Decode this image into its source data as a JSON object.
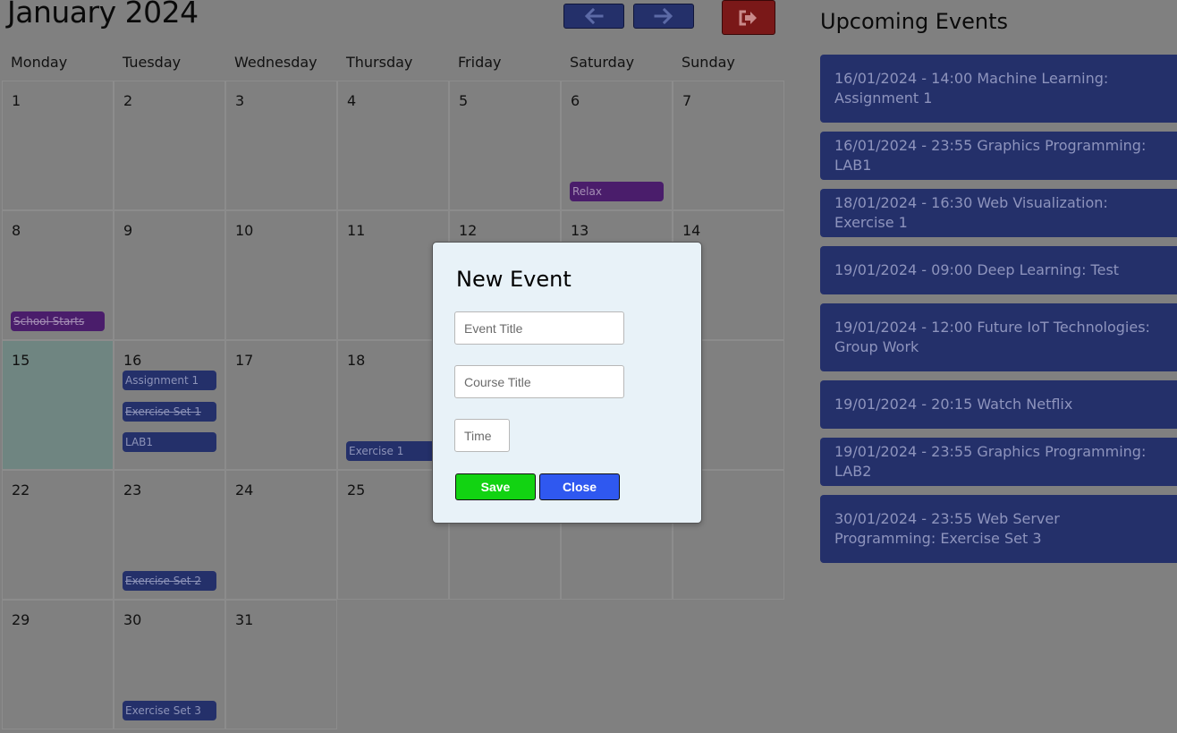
{
  "header": {
    "month_title": "January 2024"
  },
  "colors": {
    "event_blue": "#24306a",
    "event_purple": "#4a1d6b",
    "today": "#6f8581",
    "save": "#12d312",
    "close": "#2f58f0",
    "logout": "#7a1818"
  },
  "icons": {
    "prev": "arrow-left-icon",
    "next": "arrow-right-icon",
    "logout": "sign-out-icon"
  },
  "weekdays": [
    "Monday",
    "Tuesday",
    "Wednesday",
    "Thursday",
    "Friday",
    "Saturday",
    "Sunday"
  ],
  "calendar": {
    "days": [
      {
        "day": "1",
        "events": []
      },
      {
        "day": "2",
        "events": []
      },
      {
        "day": "3",
        "events": []
      },
      {
        "day": "4",
        "events": []
      },
      {
        "day": "5",
        "events": []
      },
      {
        "day": "6",
        "events": [
          {
            "label": "Relax",
            "color": "purple",
            "done": false
          }
        ]
      },
      {
        "day": "7",
        "events": []
      },
      {
        "day": "8",
        "events": [
          {
            "label": "School Starts",
            "color": "purple",
            "done": true
          }
        ]
      },
      {
        "day": "9",
        "events": []
      },
      {
        "day": "10",
        "events": []
      },
      {
        "day": "11",
        "events": []
      },
      {
        "day": "12",
        "events": []
      },
      {
        "day": "13",
        "events": []
      },
      {
        "day": "14",
        "events": []
      },
      {
        "day": "15",
        "events": [],
        "today": true
      },
      {
        "day": "16",
        "events": [
          {
            "label": "Assignment 1",
            "color": "blue",
            "done": false
          },
          {
            "label": "Exercise Set 1",
            "color": "blue",
            "done": true
          },
          {
            "label": "LAB1",
            "color": "blue",
            "done": false
          }
        ]
      },
      {
        "day": "17",
        "events": []
      },
      {
        "day": "18",
        "events": [
          {
            "label": "Exercise 1",
            "color": "blue",
            "done": false
          }
        ]
      },
      {
        "day": "",
        "events": []
      },
      {
        "day": "",
        "events": []
      },
      {
        "day": "",
        "events": []
      },
      {
        "day": "22",
        "events": []
      },
      {
        "day": "23",
        "events": [
          {
            "label": "Exercise Set 2",
            "color": "blue",
            "done": true
          }
        ]
      },
      {
        "day": "24",
        "events": []
      },
      {
        "day": "25",
        "events": []
      },
      {
        "day": "",
        "events": []
      },
      {
        "day": "",
        "events": []
      },
      {
        "day": "",
        "events": []
      },
      {
        "day": "29",
        "events": []
      },
      {
        "day": "30",
        "events": [
          {
            "label": "Exercise Set 3",
            "color": "blue",
            "done": false
          }
        ]
      },
      {
        "day": "31",
        "events": []
      }
    ]
  },
  "upcoming": {
    "title": "Upcoming Events",
    "events": [
      "16/01/2024 - 14:00 Machine Learning: Assignment 1",
      "16/01/2024 - 23:55 Graphics Programming: LAB1",
      "18/01/2024 - 16:30 Web Visualization: Exercise 1",
      "19/01/2024 - 09:00 Deep Learning: Test",
      "19/01/2024 - 12:00 Future IoT Technologies: Group Work",
      "19/01/2024 - 20:15 Watch Netflix",
      "19/01/2024 - 23:55 Graphics Programming: LAB2",
      "30/01/2024 - 23:55 Web Server Programming: Exercise Set 3"
    ]
  },
  "modal": {
    "title": "New Event",
    "event_title_placeholder": "Event Title",
    "course_title_placeholder": "Course Title",
    "time_placeholder": "Time",
    "save_label": "Save",
    "close_label": "Close"
  }
}
